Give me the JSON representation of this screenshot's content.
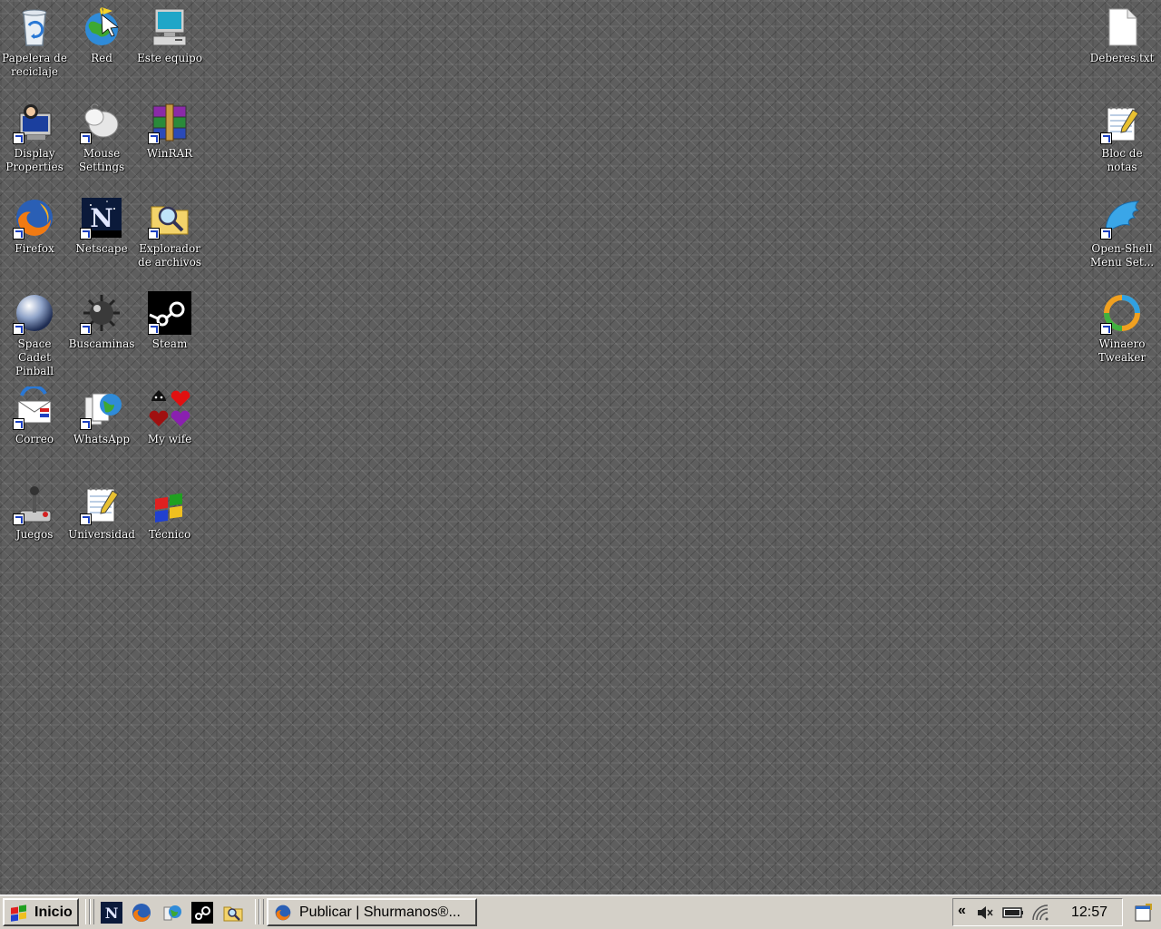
{
  "desktop_icons": {
    "recycle_bin": "Papelera de reciclaje",
    "network": "Red",
    "this_pc": "Este equipo",
    "display_properties": "Display Properties",
    "mouse_settings": "Mouse Settings",
    "winrar": "WinRAR",
    "firefox": "Firefox",
    "netscape": "Netscape",
    "file_explorer": "Explorador de archivos",
    "pinball": "Space Cadet Pinball",
    "minesweeper": "Buscaminas",
    "steam": "Steam",
    "mail": "Correo",
    "whatsapp": "WhatsApp",
    "my_wife": "My wife",
    "games": "Juegos",
    "university": "Universidad",
    "technical": "Técnico",
    "homework_txt": "Deberes.txt",
    "notepad": "Bloc de notas",
    "open_shell": "Open-Shell Menu Set...",
    "winaero": "Winaero Tweaker"
  },
  "taskbar": {
    "start_label": "Inicio",
    "task_firefox_title": "Publicar | Shurmanos®...",
    "tray_expand": "«",
    "clock": "12:57"
  },
  "icons": {
    "start": "windows-flag-icon",
    "quick_launch": [
      "netscape-icon",
      "firefox-icon",
      "globe-icon",
      "steam-icon",
      "explorer-icon"
    ],
    "tray": [
      "mute-icon",
      "battery-icon",
      "wifi-icon"
    ]
  }
}
